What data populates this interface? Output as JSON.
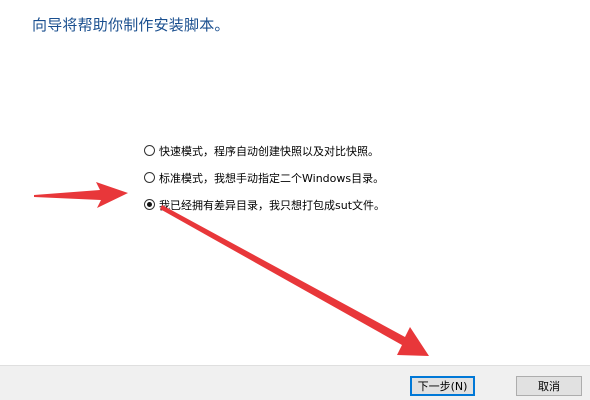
{
  "header": {
    "title": "向导将帮助你制作安装脚本。"
  },
  "options": [
    {
      "label": "快速模式，程序自动创建快照以及对比快照。",
      "selected": false
    },
    {
      "label": "标准模式，我想手动指定二个Windows目录。",
      "selected": false
    },
    {
      "label": "我已经拥有差异目录，我只想打包成sut文件。",
      "selected": true
    }
  ],
  "footer": {
    "next_label": "下一步(N)",
    "cancel_label": "取消"
  },
  "colors": {
    "title": "#1a4f8f",
    "arrow": "#e8373a",
    "footer_bg": "#f0f0f0",
    "button_focus_border": "#0078d7"
  }
}
